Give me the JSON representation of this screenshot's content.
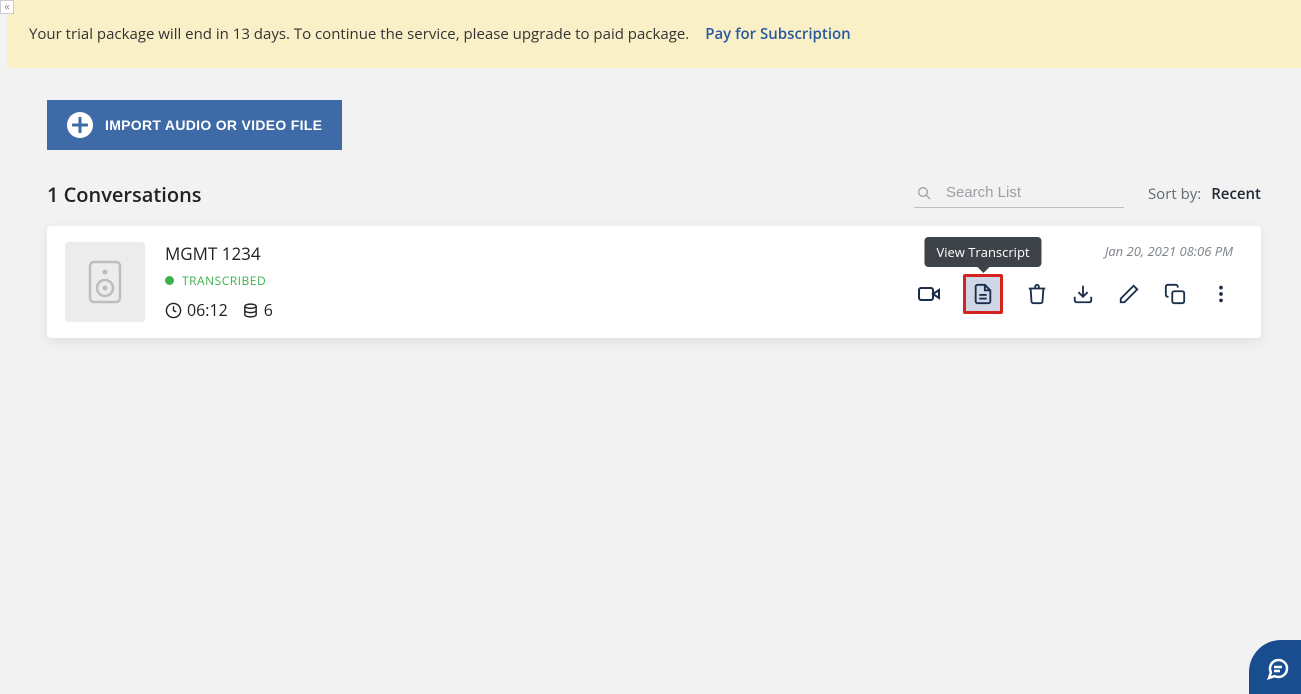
{
  "banner": {
    "text": "Your trial package will end in 13 days. To continue the service, please upgrade to paid package.",
    "link_label": "Pay for Subscription"
  },
  "import_button": {
    "label": "IMPORT AUDIO OR VIDEO FILE"
  },
  "list": {
    "title": "1 Conversations",
    "search_placeholder": "Search List",
    "sort_label": "Sort by:",
    "sort_value": "Recent"
  },
  "conversation": {
    "title": "MGMT 1234",
    "status": "TRANSCRIBED",
    "duration": "06:12",
    "segments": "6",
    "date": "Jan 20, 2021 08:06 PM",
    "tooltip": "View Transcript"
  }
}
